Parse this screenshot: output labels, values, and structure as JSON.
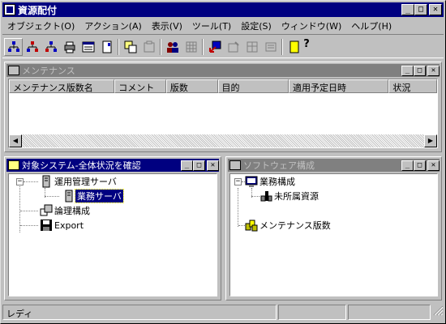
{
  "window": {
    "title": "資源配付"
  },
  "window_buttons": {
    "minimize": "_",
    "maximize": "□",
    "close": "✕"
  },
  "menu": [
    "オブジェクト(O)",
    "アクション(A)",
    "表示(V)",
    "ツール(T)",
    "設定(S)",
    "ウィンドウ(W)",
    "ヘルプ(H)"
  ],
  "toolbar": {
    "help_glyph": "?"
  },
  "maintenance_panel": {
    "title": "メンテナンス",
    "columns": [
      "メンテナンス版数名",
      "コメント",
      "版数",
      "目的",
      "適用予定日時",
      "状況"
    ]
  },
  "scroll": {
    "left": "◀",
    "right": "▶"
  },
  "system_panel": {
    "title": "対象システム-全体状況を確認",
    "nodes": {
      "ops_server": "運用管理サーバ",
      "business_server": "業務サーバ",
      "logical": "論理構成",
      "export": "Export"
    }
  },
  "software_panel": {
    "title": "ソフトウェア構成",
    "nodes": {
      "business": "業務構成",
      "unassigned": "未所属資源",
      "maint_version": "メンテナンス版数"
    }
  },
  "tree_glyphs": {
    "minus": "−"
  },
  "status": {
    "text": "レディ"
  },
  "colors": {
    "active_title": "#000080",
    "inactive_title": "#808080",
    "face": "#c0c0c0"
  }
}
